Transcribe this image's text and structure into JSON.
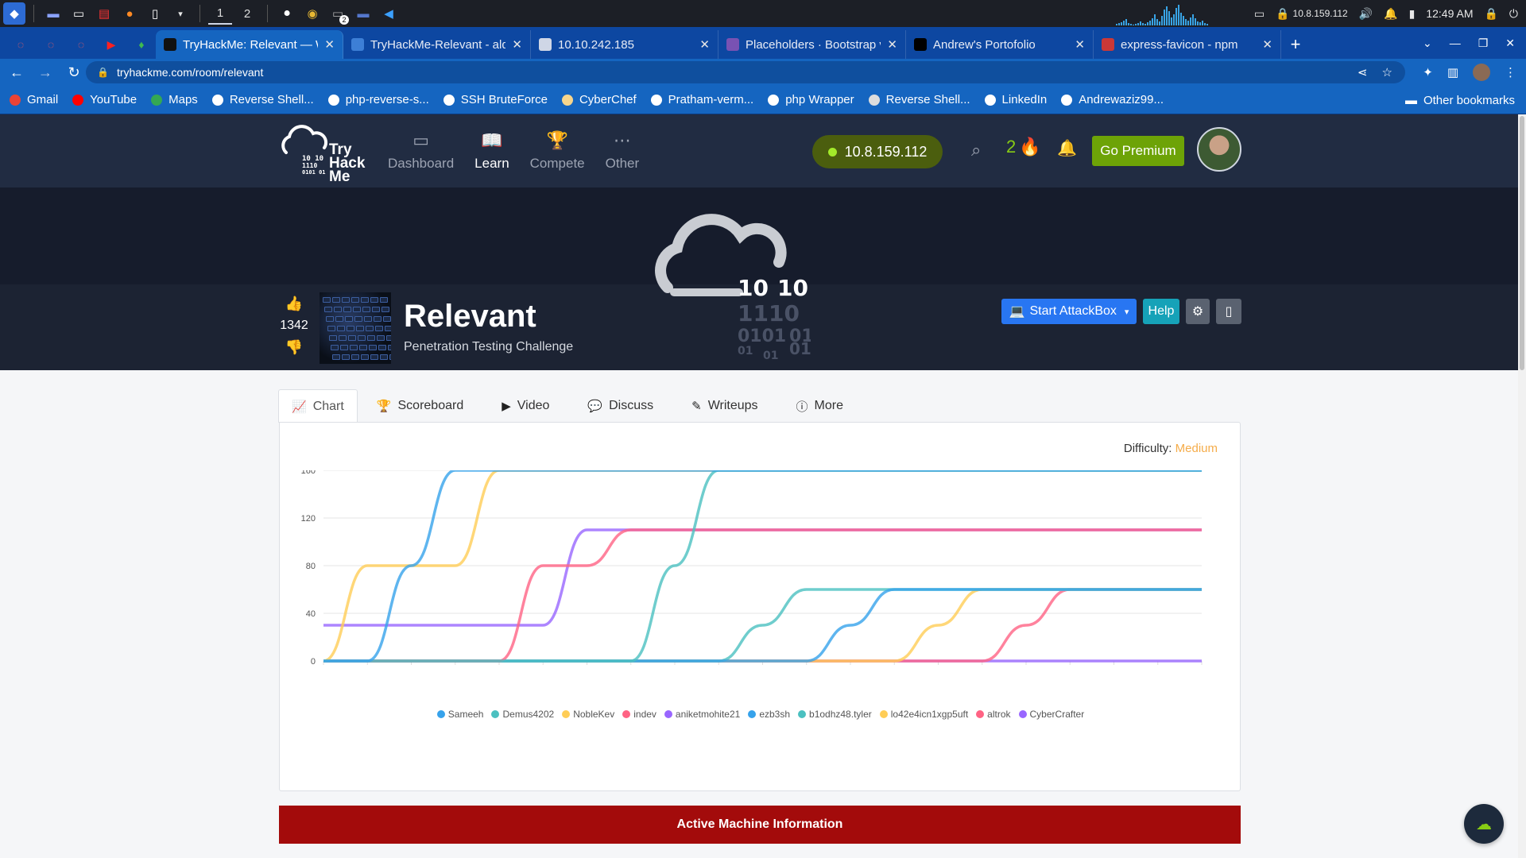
{
  "taskbar": {
    "workspaces": [
      "1",
      "2"
    ],
    "active_workspace": "1",
    "chrome_badge": "2",
    "vpn_ip": "10.8.159.112",
    "time": "12:49 AM"
  },
  "tabs": [
    {
      "title": "TryHackMe: Relevant — W",
      "color": "#111111",
      "active": true
    },
    {
      "title": "TryHackMe-Relevant - ald",
      "color": "#3d7fd6",
      "active": false
    },
    {
      "title": "10.10.242.185",
      "color": "#cfd6e6",
      "active": false
    },
    {
      "title": "Placeholders · Bootstrap v",
      "color": "#7952b3",
      "active": false
    },
    {
      "title": "Andrew's Portofolio",
      "color": "#000000",
      "active": false
    },
    {
      "title": "express-favicon - npm",
      "color": "#cb3837",
      "active": false
    }
  ],
  "address": {
    "url": "tryhackme.com/room/relevant"
  },
  "bookmarks": [
    {
      "label": "Gmail",
      "color": "#ea4335"
    },
    {
      "label": "YouTube",
      "color": "#ff0000"
    },
    {
      "label": "Maps",
      "color": "#34a853"
    },
    {
      "label": "Reverse Shell...",
      "color": "#ffffff"
    },
    {
      "label": "php-reverse-s...",
      "color": "#ffffff"
    },
    {
      "label": "SSH BruteForce",
      "color": "#ffffff"
    },
    {
      "label": "CyberChef",
      "color": "#f7d58c"
    },
    {
      "label": "Pratham-verm...",
      "color": "#ffffff"
    },
    {
      "label": "php Wrapper",
      "color": "#ffffff"
    },
    {
      "label": "Reverse Shell...",
      "color": "#dddddd"
    },
    {
      "label": "LinkedIn",
      "color": "#ffffff"
    },
    {
      "label": "Andrewaziz99...",
      "color": "#ffffff"
    }
  ],
  "other_bookmarks": "Other bookmarks",
  "thm_nav": {
    "logo_text": "Try\nHack\nMe",
    "items": [
      {
        "label": "Dashboard",
        "icon": "dashboard-icon",
        "active": false
      },
      {
        "label": "Learn",
        "icon": "book-icon",
        "active": true
      },
      {
        "label": "Compete",
        "icon": "trophy-icon",
        "active": false
      },
      {
        "label": "Other",
        "icon": "more-icon",
        "active": false
      }
    ],
    "ip": "10.8.159.112",
    "streak": "2",
    "premium_label": "Go Premium"
  },
  "room": {
    "votes": "1342",
    "title": "Relevant",
    "subtitle": "Penetration Testing Challenge",
    "attackbox_label": "Start AttackBox",
    "help_label": "Help",
    "logo_binary": [
      "10",
      "10",
      "1110",
      "0101",
      "01",
      "01",
      "010",
      "01"
    ]
  },
  "content_tabs": [
    {
      "label": "Chart",
      "icon": "chart-icon",
      "active": true
    },
    {
      "label": "Scoreboard",
      "icon": "trophy-icon",
      "active": false
    },
    {
      "label": "Video",
      "icon": "play-icon",
      "active": false
    },
    {
      "label": "Discuss",
      "icon": "comments-icon",
      "active": false
    },
    {
      "label": "Writeups",
      "icon": "pen-icon",
      "active": false
    },
    {
      "label": "More",
      "icon": "info-icon",
      "active": false
    }
  ],
  "difficulty": {
    "label": "Difficulty:",
    "value": "Medium"
  },
  "chart_data": {
    "type": "line",
    "ylim": [
      0,
      160
    ],
    "yticks": [
      0,
      40,
      80,
      120,
      160
    ],
    "x": [
      0,
      1,
      2,
      3,
      4,
      5,
      6,
      7,
      8,
      9,
      10,
      11,
      12,
      13,
      14,
      15,
      16,
      17,
      18,
      19,
      20
    ],
    "series": [
      {
        "name": "Sameeh",
        "color": "#36a2eb",
        "values": [
          0,
          0,
          80,
          160,
          160,
          160,
          160,
          160,
          160,
          160,
          160,
          160,
          160,
          160,
          160,
          160,
          160,
          160,
          160,
          160,
          160
        ]
      },
      {
        "name": "Demus4202",
        "color": "#4bc0c0",
        "values": [
          0,
          0,
          0,
          0,
          0,
          0,
          0,
          0,
          80,
          160,
          160,
          160,
          160,
          160,
          160,
          160,
          160,
          160,
          160,
          160,
          160
        ]
      },
      {
        "name": "NobleKev",
        "color": "#ffcd56",
        "values": [
          0,
          80,
          80,
          80,
          160,
          160,
          160,
          160,
          160,
          160,
          160,
          160,
          160,
          160,
          160,
          160,
          160,
          160,
          160,
          160,
          160
        ]
      },
      {
        "name": "indev",
        "color": "#ff6384",
        "values": [
          0,
          0,
          0,
          0,
          0,
          80,
          80,
          110,
          110,
          110,
          110,
          110,
          110,
          110,
          110,
          110,
          110,
          110,
          110,
          110,
          110
        ]
      },
      {
        "name": "aniketmohite21",
        "color": "#9966ff",
        "values": [
          30,
          30,
          30,
          30,
          30,
          30,
          110,
          110,
          110,
          110,
          110,
          110,
          110,
          110,
          110,
          110,
          110,
          110,
          110,
          110,
          110
        ]
      },
      {
        "name": "ezb3sh",
        "color": "#36a2eb",
        "values": [
          0,
          0,
          0,
          0,
          0,
          0,
          0,
          0,
          0,
          0,
          0,
          0,
          30,
          60,
          60,
          60,
          60,
          60,
          60,
          60,
          60
        ]
      },
      {
        "name": "b1odhz48.tyler",
        "color": "#4bc0c0",
        "values": [
          0,
          0,
          0,
          0,
          0,
          0,
          0,
          0,
          0,
          0,
          30,
          60,
          60,
          60,
          60,
          60,
          60,
          60,
          60,
          60,
          60
        ]
      },
      {
        "name": "lo42e4icn1xgp5uft",
        "color": "#ffcd56",
        "values": [
          0,
          0,
          0,
          0,
          0,
          0,
          0,
          0,
          0,
          0,
          0,
          0,
          0,
          0,
          30,
          60,
          60,
          60,
          60,
          60,
          60
        ]
      },
      {
        "name": "altrok",
        "color": "#ff6384",
        "values": [
          0,
          0,
          0,
          0,
          0,
          0,
          0,
          0,
          0,
          0,
          0,
          0,
          0,
          0,
          0,
          0,
          30,
          60,
          60,
          60,
          60
        ]
      },
      {
        "name": "CyberCrafter",
        "color": "#9966ff",
        "values": [
          0,
          0,
          0,
          0,
          0,
          0,
          0,
          0,
          0,
          0,
          0,
          0,
          0,
          0,
          0,
          0,
          0,
          0,
          0,
          0,
          0
        ]
      }
    ],
    "legend_position": "bottom",
    "grid": true
  },
  "active_machine_label": "Active Machine Information"
}
